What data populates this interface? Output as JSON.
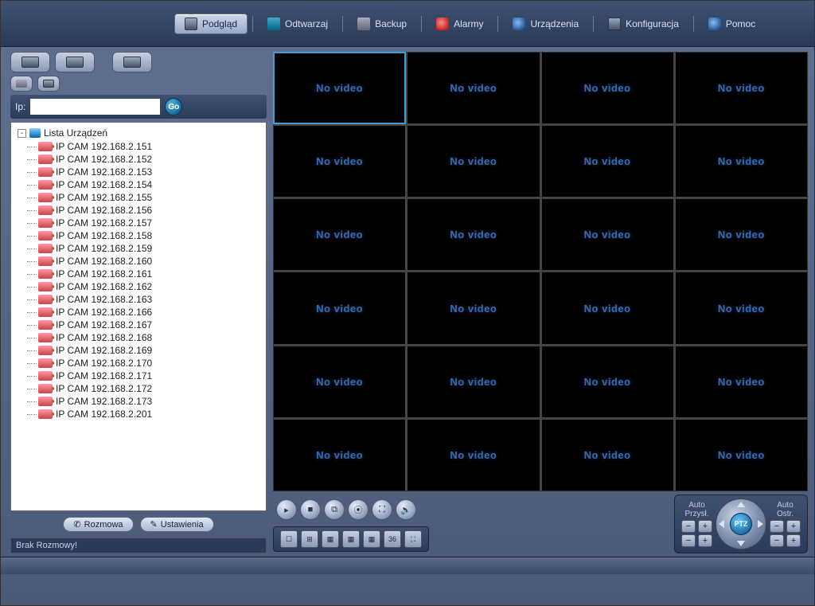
{
  "toolbar": {
    "preview": "Podgląd",
    "playback": "Odtwarzaj",
    "backup": "Backup",
    "alarms": "Alarmy",
    "devices": "Urządzenia",
    "config": "Konfiguracja",
    "help": "Pomoc"
  },
  "sidebar": {
    "ip_label": "Ip:",
    "ip_value": "",
    "go_label": "Go",
    "tree_root": "Lista Urządzeń",
    "devices": [
      "IP CAM 192.168.2.151",
      "IP CAM 192.168.2.152",
      "IP CAM 192.168.2.153",
      "IP CAM 192.168.2.154",
      "IP CAM 192.168.2.155",
      "IP CAM 192.168.2.156",
      "IP CAM 192.168.2.157",
      "IP CAM 192.168.2.158",
      "IP CAM 192.168.2.159",
      "IP CAM 192.168.2.160",
      "IP CAM 192.168.2.161",
      "IP CAM 192.168.2.162",
      "IP CAM 192.168.2.163",
      "IP CAM 192.168.2.166",
      "IP CAM 192.168.2.167",
      "IP CAM 192.168.2.168",
      "IP CAM 192.168.2.169",
      "IP CAM 192.168.2.170",
      "IP CAM 192.168.2.171",
      "IP CAM 192.168.2.172",
      "IP CAM 192.168.2.173",
      "IP CAM 192.168.2.201"
    ],
    "talk_btn": "Rozmowa",
    "settings_btn": "Ustawienia",
    "status": "Brak Rozmowy!"
  },
  "video": {
    "placeholder": "No video",
    "selected_index": 0,
    "cell_count": 24
  },
  "controls": {
    "layout_36": "36",
    "ptz_center": "PTZ",
    "zoom_label": "Auto\nPrzysł.",
    "focus_label": "Auto\nOstr."
  }
}
